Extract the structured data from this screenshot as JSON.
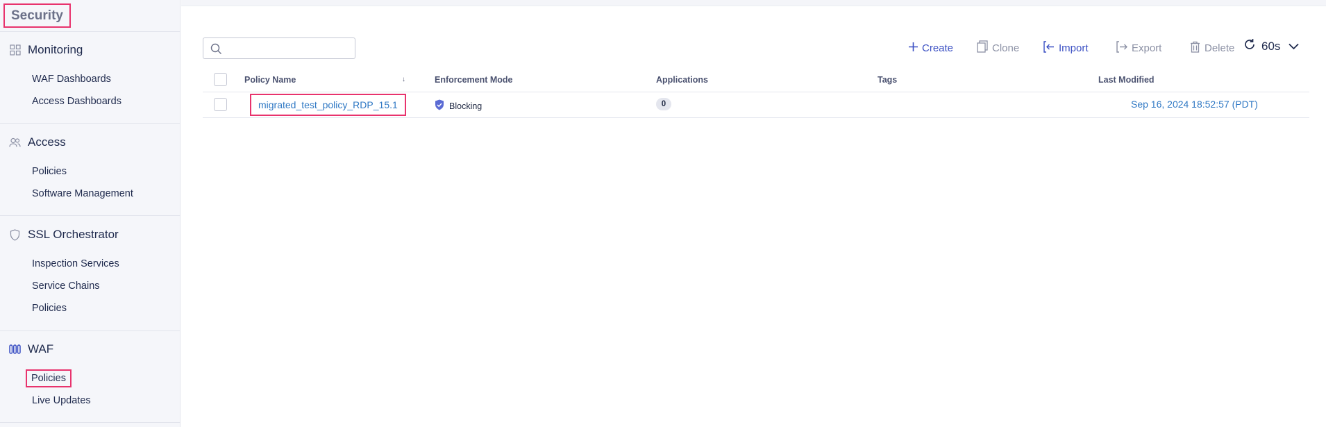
{
  "sidebar": {
    "app_title": "Security",
    "sections": [
      {
        "label": "Monitoring",
        "icon": "grid-icon",
        "items": [
          "WAF Dashboards",
          "Access Dashboards"
        ]
      },
      {
        "label": "Access",
        "icon": "users-icon",
        "items": [
          "Policies",
          "Software Management"
        ]
      },
      {
        "label": "SSL Orchestrator",
        "icon": "shield-icon",
        "items": [
          "Inspection Services",
          "Service Chains",
          "Policies"
        ]
      },
      {
        "label": "WAF",
        "icon": "waf-icon",
        "items": [
          "Policies",
          "Live Updates"
        ],
        "selected_item": "Policies"
      }
    ]
  },
  "search": {
    "placeholder": "",
    "icon": "search-icon"
  },
  "toolbar": {
    "create": "Create",
    "clone": "Clone",
    "import": "Import",
    "export": "Export",
    "delete": "Delete",
    "refresh_interval": "60s"
  },
  "table": {
    "columns": [
      "Policy Name",
      "Enforcement Mode",
      "Applications",
      "Tags",
      "Last Modified"
    ],
    "sort_icon": "sort-down-icon",
    "rows": [
      {
        "policy_name": "migrated_test_policy_RDP_15.1",
        "enforcement_mode": "Blocking",
        "applications": "0",
        "tags": "",
        "last_modified": "Sep 16, 2024 18:52:57 (PDT)"
      }
    ]
  },
  "colors": {
    "accent": "#3a4fc3",
    "link": "#2f78c4",
    "highlight": "#e8336d",
    "sidebar_bg": "#f5f6fa"
  }
}
